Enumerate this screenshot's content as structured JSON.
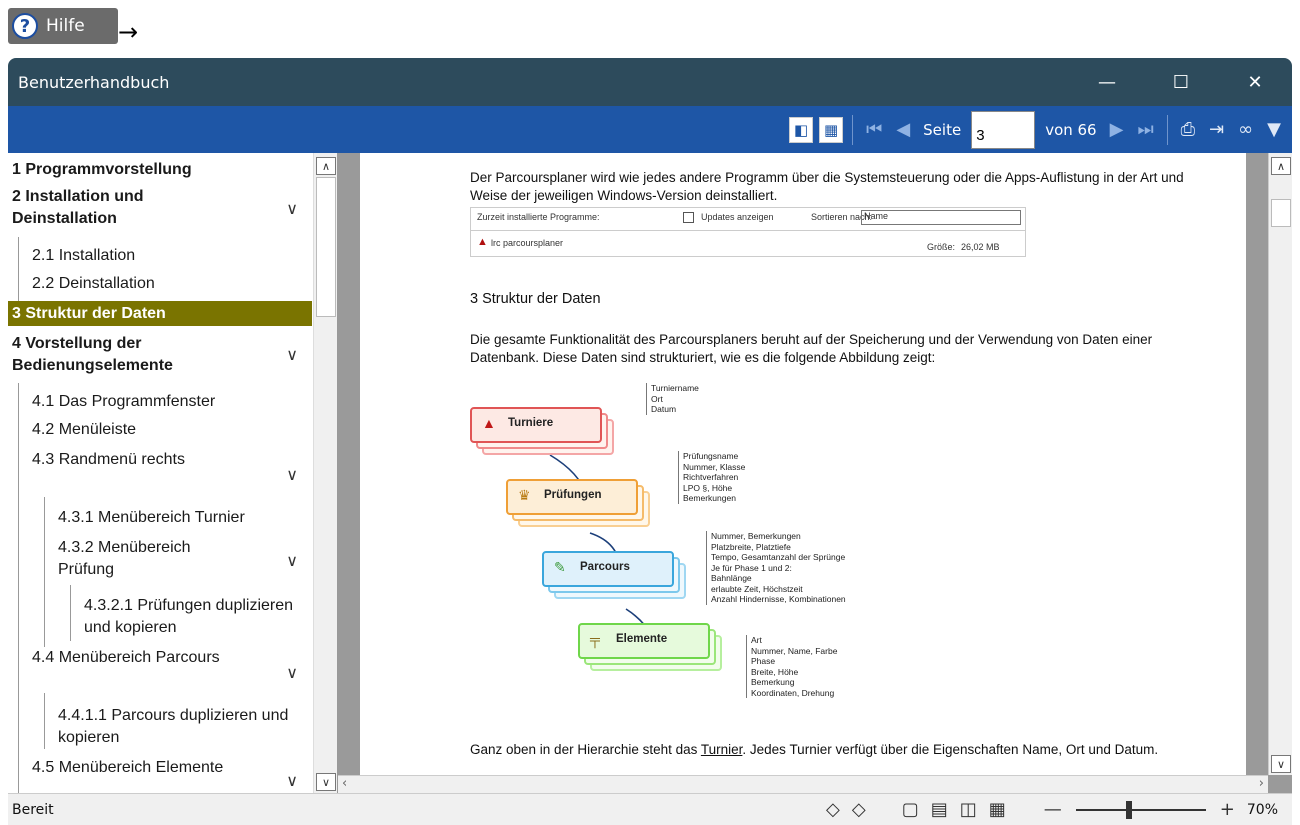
{
  "help": {
    "label": "Hilfe",
    "arrow": "→"
  },
  "window": {
    "title": "Benutzerhandbuch",
    "controls": {
      "minimize": "—",
      "maximize": "☐",
      "close": "✕"
    }
  },
  "toolbar": {
    "page_label": "Seite",
    "page_value": "3",
    "of_label": "von 66"
  },
  "toc": {
    "items": [
      {
        "label": "1 Programmvorstellung"
      },
      {
        "label": "2 Installation und"
      },
      {
        "label": "Deinstallation"
      },
      {
        "label": "2.1 Installation"
      },
      {
        "label": "2.2 Deinstallation"
      },
      {
        "label": "3 Struktur der Daten"
      },
      {
        "label": "4 Vorstellung der"
      },
      {
        "label": "Bedienungselemente"
      },
      {
        "label": "4.1 Das Programmfenster"
      },
      {
        "label": "4.2 Menüleiste"
      },
      {
        "label": "4.3 Randmenü rechts"
      },
      {
        "label": "4.3.1 Menübereich Turnier"
      },
      {
        "label": "4.3.2 Menübereich"
      },
      {
        "label": "Prüfung"
      },
      {
        "label": "4.3.2.1 Prüfungen duplizieren"
      },
      {
        "label": "und kopieren"
      },
      {
        "label": "4.4 Menübereich Parcours"
      },
      {
        "label": "4.4.1.1 Parcours duplizieren und"
      },
      {
        "label": "kopieren"
      },
      {
        "label": "4.5  Menübereich Elemente"
      }
    ]
  },
  "document": {
    "intro": "Der Parcoursplaner wird wie jedes andere Programm über die Systemsteuerung oder die Apps-Auflistung in der Art und Weise der jeweiligen Windows-Version deinstalliert.",
    "programs_strip": {
      "installed_label": "Zurzeit installierte Programme:",
      "updates_label": "Updates anzeigen",
      "sort_label": "Sortieren nach:",
      "sort_value": "Name",
      "app_name": "lrc parcoursplaner",
      "size_label": "Größe:",
      "size_value": "26,02 MB"
    },
    "heading": "3  Struktur der Daten",
    "body": "Die gesamte Funktionalität des Parcoursplaners beruht auf der Speicherung und der Verwendung von Daten einer Datenbank. Diese Daten sind strukturiert, wie es die folgende Abbildung zeigt:",
    "diagram": {
      "nodes": [
        {
          "label": "Turniere",
          "attrs": [
            "Turniername",
            "Ort",
            "Datum"
          ]
        },
        {
          "label": "Prüfungen",
          "attrs": [
            "Prüfungsname",
            "Nummer, Klasse",
            "Richtverfahren",
            "LPO §, Höhe",
            "Bemerkungen"
          ]
        },
        {
          "label": "Parcours",
          "attrs": [
            "Nummer, Bemerkungen",
            "Platzbreite, Platztiefe",
            "Tempo, Gesamtanzahl der Sprünge",
            "Je für Phase 1 und 2:",
            "Bahnlänge",
            "erlaubte Zeit, Höchstzeit",
            "Anzahl Hindernisse, Kombinationen"
          ]
        },
        {
          "label": "Elemente",
          "attrs": [
            "Art",
            "Nummer, Name, Farbe",
            "Phase",
            "Breite, Höhe",
            "Bemerkung",
            "Koordinaten, Drehung"
          ]
        }
      ]
    },
    "footer_pre": "Ganz oben in der Hierarchie steht das ",
    "footer_link": "Turnier",
    "footer_post": ". Jedes Turnier verfügt über die Eigenschaften Name, Ort und Datum."
  },
  "status": {
    "ready": "Bereit",
    "zoom": "70%"
  },
  "colors": {
    "titlebar": "#2d4b5c",
    "toolbar": "#1e56a6",
    "active_toc": "#7a7400"
  }
}
